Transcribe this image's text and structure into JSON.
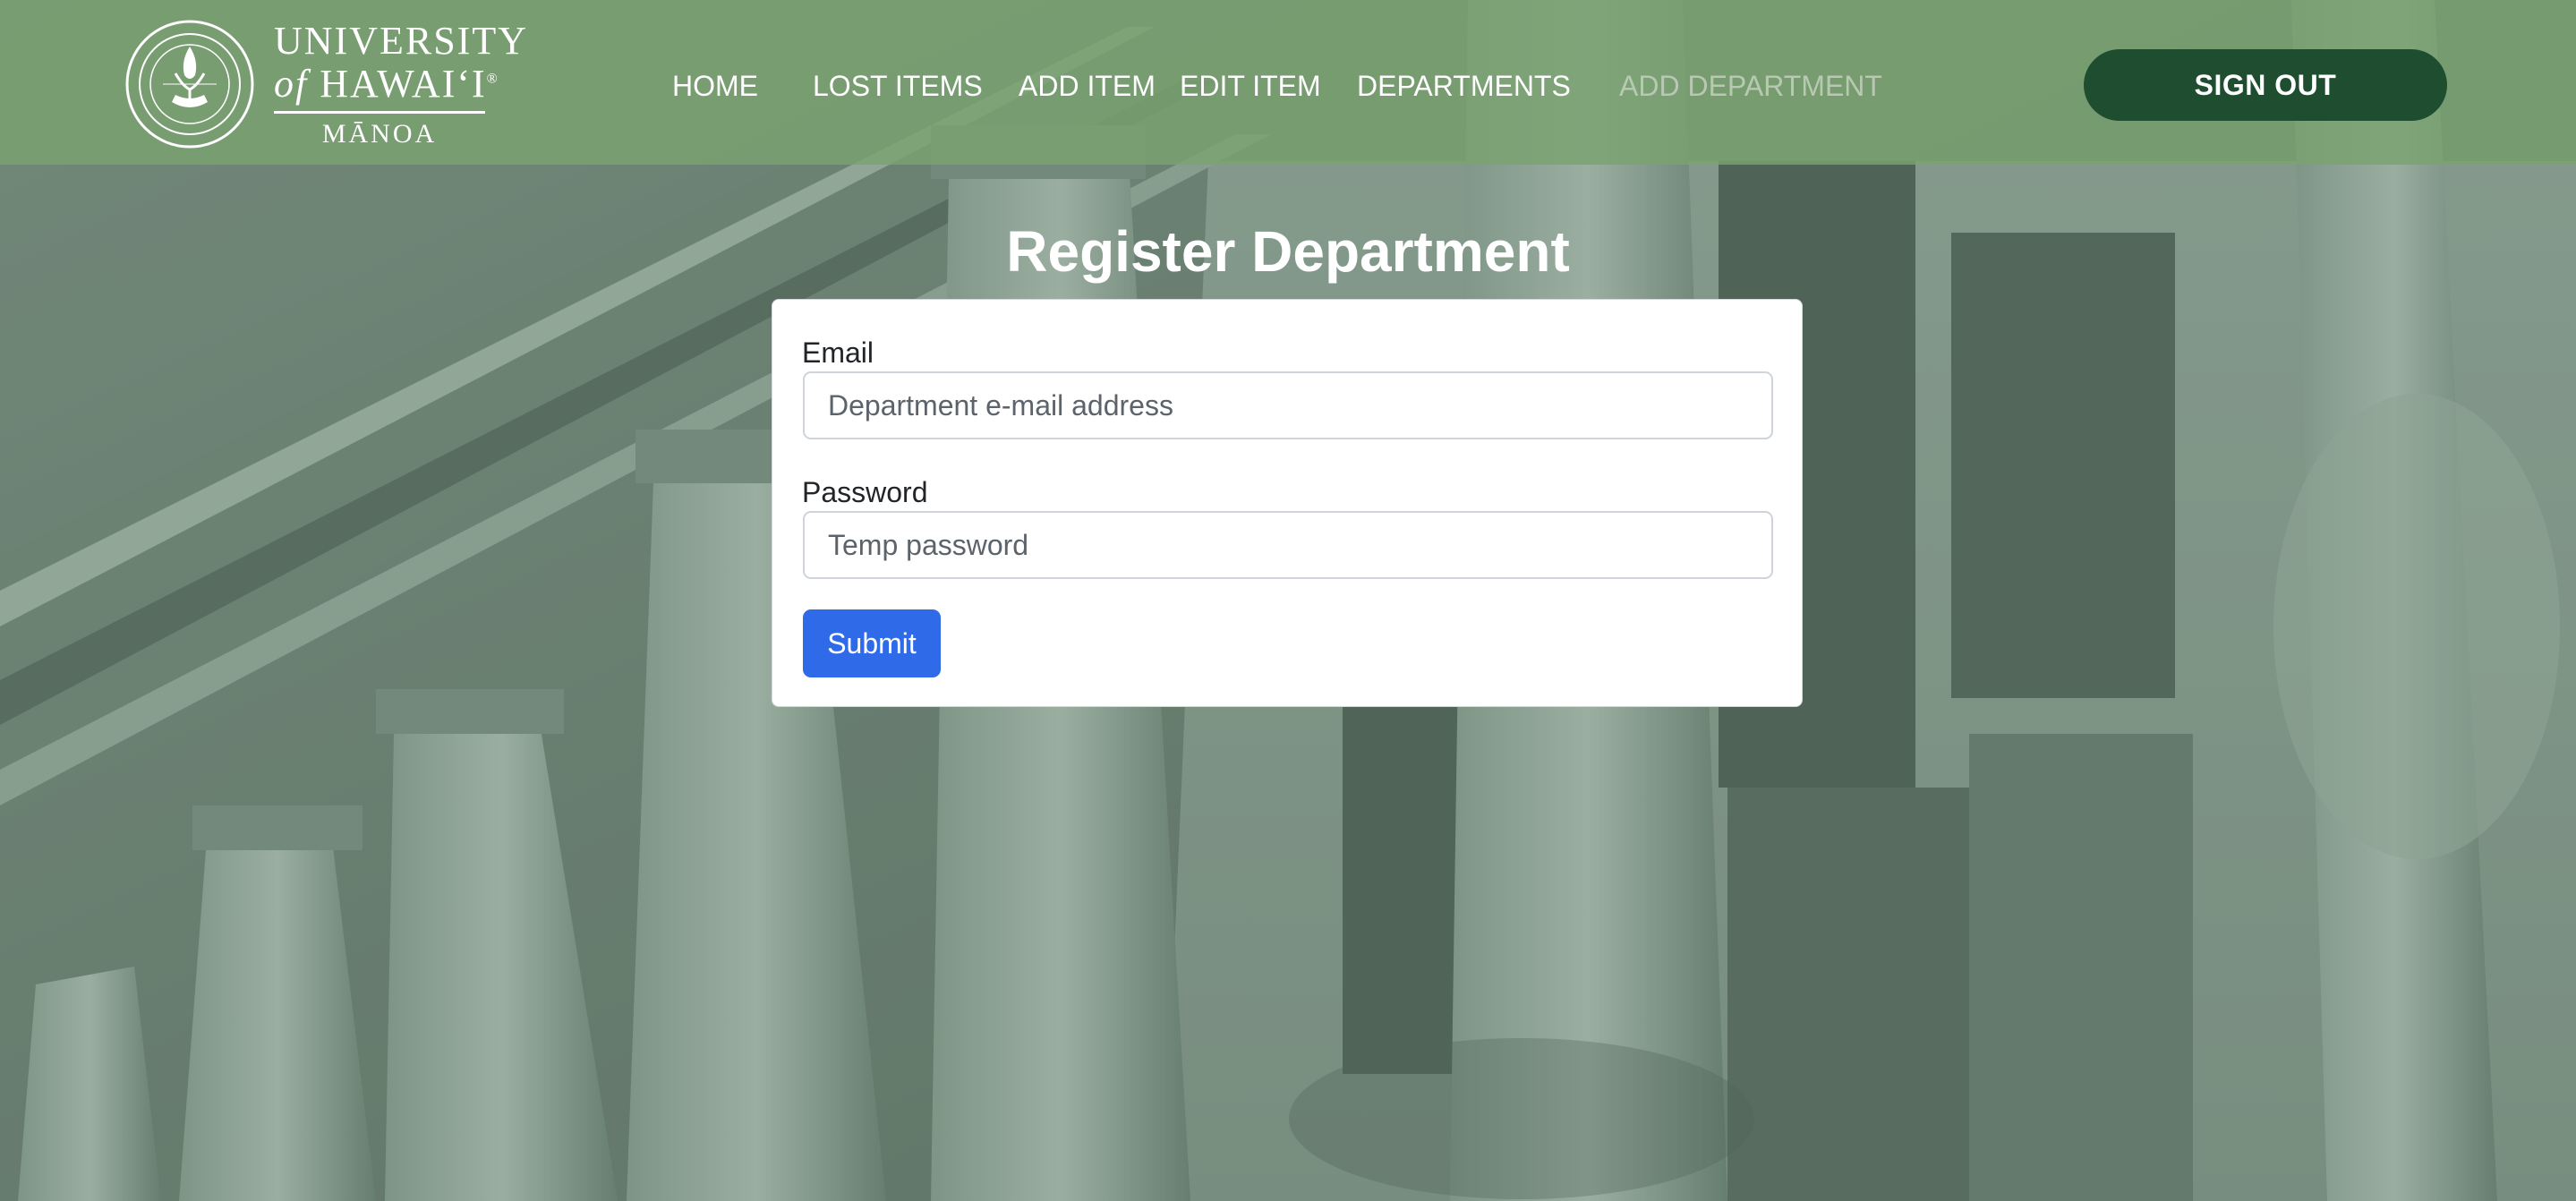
{
  "brand": {
    "line1": "UNIVERSITY",
    "line2_of": "of",
    "line2_name": "HAWAI‘I",
    "line2_mark": "®",
    "line3": "MĀNOA",
    "seal_icon": "university-seal-icon"
  },
  "nav": {
    "items": [
      {
        "label": "HOME"
      },
      {
        "label": "LOST ITEMS"
      },
      {
        "label": "ADD ITEM"
      },
      {
        "label": "EDIT ITEM"
      },
      {
        "label": "DEPARTMENTS"
      },
      {
        "label": "ADD DEPARTMENT",
        "active": true
      }
    ],
    "sign_out_label": "SIGN OUT"
  },
  "page": {
    "title": "Register Department"
  },
  "form": {
    "email_label": "Email",
    "email_placeholder": "Department e-mail address",
    "email_value": "",
    "password_label": "Password",
    "password_placeholder": "Temp password",
    "password_value": "",
    "submit_label": "Submit"
  },
  "colors": {
    "navbar": "#7aa270",
    "sign_out": "#1e4d2f",
    "submit": "#2f6ae8",
    "active_nav": "#b8c9b2"
  }
}
